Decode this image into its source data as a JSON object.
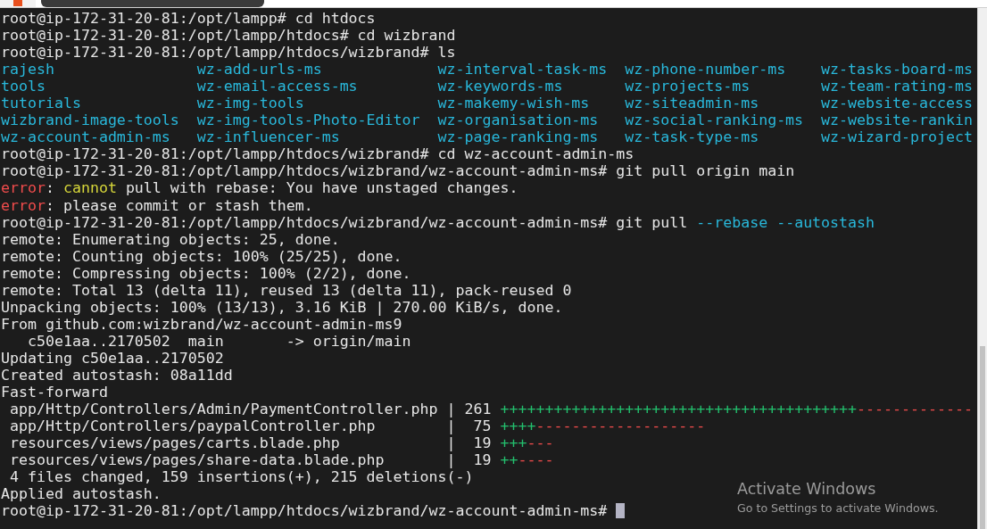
{
  "lines_top": [
    {
      "segments": [
        {
          "text": "root@ip-172-31-20-81:/opt/lampp# cd htdocs",
          "color": "#e6e6e6"
        }
      ]
    },
    {
      "segments": [
        {
          "text": "root@ip-172-31-20-81:/opt/lampp/htdocs# cd wizbrand",
          "color": "#e6e6e6"
        }
      ]
    },
    {
      "segments": [
        {
          "text": "root@ip-172-31-20-81:/opt/lampp/htdocs/wizbrand# ls",
          "color": "#e6e6e6"
        }
      ]
    }
  ],
  "ls_listing": [
    "rajesh",
    "tools",
    "tutorials",
    "wizbrand-image-tools",
    "wz-account-admin-ms",
    "wz-add-urls-ms",
    "wz-email-access-ms",
    "wz-img-tools",
    "wz-img-tools-Photo-Editor",
    "wz-influencer-ms",
    "wz-interval-task-ms",
    "wz-keywords-ms",
    "wz-makemy-wish-ms",
    "wz-organisation-ms",
    "wz-page-ranking-ms",
    "wz-phone-number-ms",
    "wz-projects-ms",
    "wz-siteadmin-ms",
    "wz-social-ranking-ms",
    "wz-task-type-ms",
    "wz-tasks-board-ms",
    "wz-team-rating-ms",
    "wz-website-access",
    "wz-website-rankin",
    "wz-wizard-project"
  ],
  "lines_bottom": [
    {
      "segments": [
        {
          "text": "root@ip-172-31-20-81:/opt/lampp/htdocs/wizbrand# cd wz-account-admin-ms",
          "color": "#e6e6e6"
        }
      ]
    },
    {
      "segments": [
        {
          "text": "root@ip-172-31-20-81:/opt/lampp/htdocs/wizbrand/wz-account-admin-ms# git pull origin main",
          "color": "#e6e6e6"
        }
      ]
    },
    {
      "segments": [
        {
          "text": "error",
          "color": "#f14c4c"
        },
        {
          "text": ": ",
          "color": "#e6e6e6"
        },
        {
          "text": "cannot",
          "color": "#d7d73a"
        },
        {
          "text": " pull with rebase: You have unstaged changes.",
          "color": "#e6e6e6"
        }
      ]
    },
    {
      "segments": [
        {
          "text": "error",
          "color": "#f14c4c"
        },
        {
          "text": ": please commit or stash them.",
          "color": "#e6e6e6"
        }
      ]
    },
    {
      "segments": [
        {
          "text": "root@ip-172-31-20-81:/opt/lampp/htdocs/wizbrand/wz-account-admin-ms# git pull ",
          "color": "#e6e6e6"
        },
        {
          "text": "--rebase --autostash",
          "color": "#29b8db"
        }
      ]
    },
    {
      "segments": [
        {
          "text": "remote: Enumerating objects: 25, done.",
          "color": "#e6e6e6"
        }
      ]
    },
    {
      "segments": [
        {
          "text": "remote: Counting objects: 100% (25/25), done.",
          "color": "#e6e6e6"
        }
      ]
    },
    {
      "segments": [
        {
          "text": "remote: Compressing objects: 100% (2/2), done.",
          "color": "#e6e6e6"
        }
      ]
    },
    {
      "segments": [
        {
          "text": "remote: Total 13 (delta 11), reused 13 (delta 11), pack-reused 0",
          "color": "#e6e6e6"
        }
      ]
    },
    {
      "segments": [
        {
          "text": "Unpacking objects: 100% (13/13), 3.16 KiB | 270.00 KiB/s, done.",
          "color": "#e6e6e6"
        }
      ]
    },
    {
      "segments": [
        {
          "text": "From github.com:wizbrand/wz-account-admin-ms9",
          "color": "#e6e6e6"
        }
      ]
    },
    {
      "segments": [
        {
          "text": "   c50e1aa..2170502  main       -> origin/main",
          "color": "#e6e6e6"
        }
      ]
    },
    {
      "segments": [
        {
          "text": "Updating c50e1aa..2170502",
          "color": "#e6e6e6"
        }
      ]
    },
    {
      "segments": [
        {
          "text": "Created autostash: 08a11dd",
          "color": "#e6e6e6"
        }
      ]
    },
    {
      "segments": [
        {
          "text": "Fast-forward",
          "color": "#e6e6e6"
        }
      ]
    },
    {
      "segments": [
        {
          "text": " app/Http/Controllers/Admin/PaymentController.php | 261 ",
          "color": "#e6e6e6"
        },
        {
          "text": "++++++++++++++++++++++++++++++++++++++++",
          "color": "#23c06e"
        },
        {
          "text": "-------------",
          "color": "#f14c4c"
        }
      ]
    },
    {
      "segments": [
        {
          "text": " app/Http/Controllers/paypalController.php        |  75 ",
          "color": "#e6e6e6"
        },
        {
          "text": "++++",
          "color": "#23c06e"
        },
        {
          "text": "-------------------",
          "color": "#f14c4c"
        }
      ]
    },
    {
      "segments": [
        {
          "text": " resources/views/pages/carts.blade.php            |  19 ",
          "color": "#e6e6e6"
        },
        {
          "text": "+++",
          "color": "#23c06e"
        },
        {
          "text": "---",
          "color": "#f14c4c"
        }
      ]
    },
    {
      "segments": [
        {
          "text": " resources/views/pages/share-data.blade.php       |  19 ",
          "color": "#e6e6e6"
        },
        {
          "text": "++",
          "color": "#23c06e"
        },
        {
          "text": "----",
          "color": "#f14c4c"
        }
      ]
    },
    {
      "segments": [
        {
          "text": " 4 files changed, 159 insertions(+), 215 deletions(-)",
          "color": "#e6e6e6"
        }
      ]
    },
    {
      "segments": [
        {
          "text": "Applied autostash.",
          "color": "#e6e6e6"
        }
      ]
    },
    {
      "segments": [
        {
          "text": "root@ip-172-31-20-81:/opt/lampp/htdocs/wizbrand/wz-account-admin-ms# ",
          "color": "#e6e6e6"
        }
      ],
      "cursor": true
    }
  ],
  "activation_notice": {
    "title": "Activate Windows",
    "subtitle": "Go to Settings to activate Windows."
  }
}
